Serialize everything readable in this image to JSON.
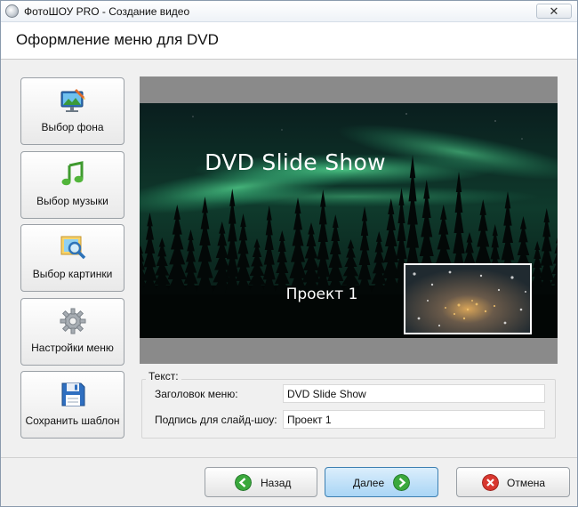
{
  "window": {
    "title": "ФотоШОУ PRO - Создание видео",
    "close_glyph": "✕"
  },
  "header": {
    "title": "Оформление меню для DVD"
  },
  "sidebar": {
    "items": [
      {
        "label": "Выбор фона",
        "icon": "monitor-paint-icon"
      },
      {
        "label": "Выбор музыки",
        "icon": "music-note-icon"
      },
      {
        "label": "Выбор  картинки",
        "icon": "image-magnifier-icon"
      },
      {
        "label": "Настройки меню",
        "icon": "gear-icon"
      },
      {
        "label": "Сохранить шаблон",
        "icon": "floppy-disk-icon"
      }
    ]
  },
  "preview": {
    "menu_title": "DVD Slide Show",
    "slide_caption": "Проект 1"
  },
  "text_section": {
    "legend": "Текст:",
    "menu_title_label": "Заголовок меню:",
    "menu_title_value": "DVD Slide Show",
    "caption_label": "Подпись для слайд-шоу:",
    "caption_value": "Проект 1"
  },
  "footer": {
    "back_label": "Назад",
    "next_label": "Далее",
    "cancel_label": "Отмена"
  },
  "colors": {
    "aurora": "#3fd08a",
    "sky_dark": "#0a1a1c",
    "active_button": "#a9d5f5",
    "back_icon": "#3aa83c",
    "cancel_icon": "#d8372f"
  }
}
